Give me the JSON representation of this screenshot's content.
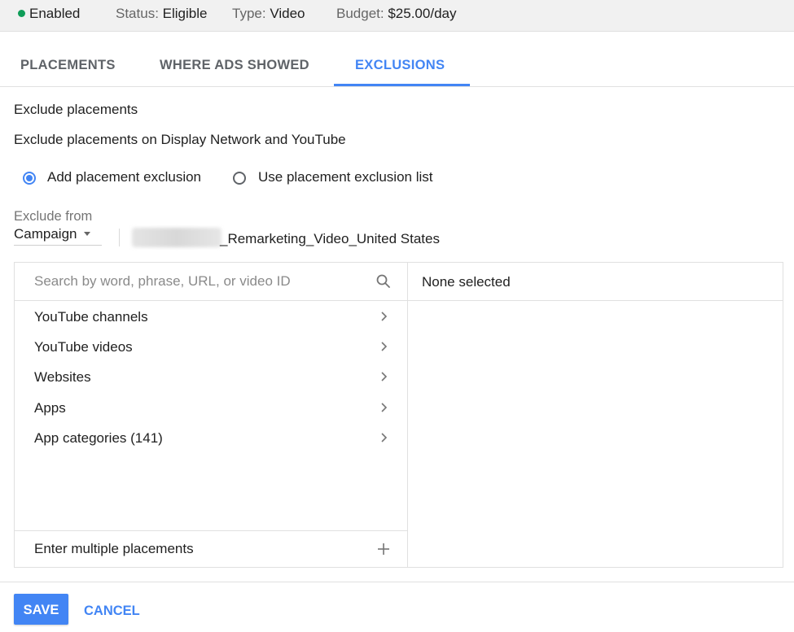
{
  "status_bar": {
    "enabled": "Enabled",
    "status_label": "Status:",
    "status_value": "Eligible",
    "type_label": "Type:",
    "type_value": "Video",
    "budget_label": "Budget:",
    "budget_value": "$25.00/day",
    "enabled_color": "#0f9d58"
  },
  "tabs": [
    {
      "label": "PLACEMENTS"
    },
    {
      "label": "WHERE ADS SHOWED"
    },
    {
      "label": "EXCLUSIONS",
      "active": true
    }
  ],
  "section": {
    "title": "Exclude placements",
    "subtitle": "Exclude placements on Display Network and YouTube",
    "radio_add": "Add placement exclusion",
    "radio_list": "Use placement exclusion list",
    "selected_radio": "Add placement exclusion"
  },
  "exclude_from": {
    "label": "Exclude from",
    "selected": "Campaign",
    "campaign_name": "_Remarketing_Video_United States"
  },
  "search": {
    "placeholder": "Search by word, phrase, URL, or video ID"
  },
  "categories": [
    "YouTube channels",
    "YouTube videos",
    "Websites",
    "Apps",
    "App categories (141)"
  ],
  "enter_multiple": "Enter multiple placements",
  "selection": {
    "none": "None selected"
  },
  "actions": {
    "save": "SAVE",
    "cancel": "CANCEL"
  },
  "colors": {
    "accent": "#4285f4"
  }
}
